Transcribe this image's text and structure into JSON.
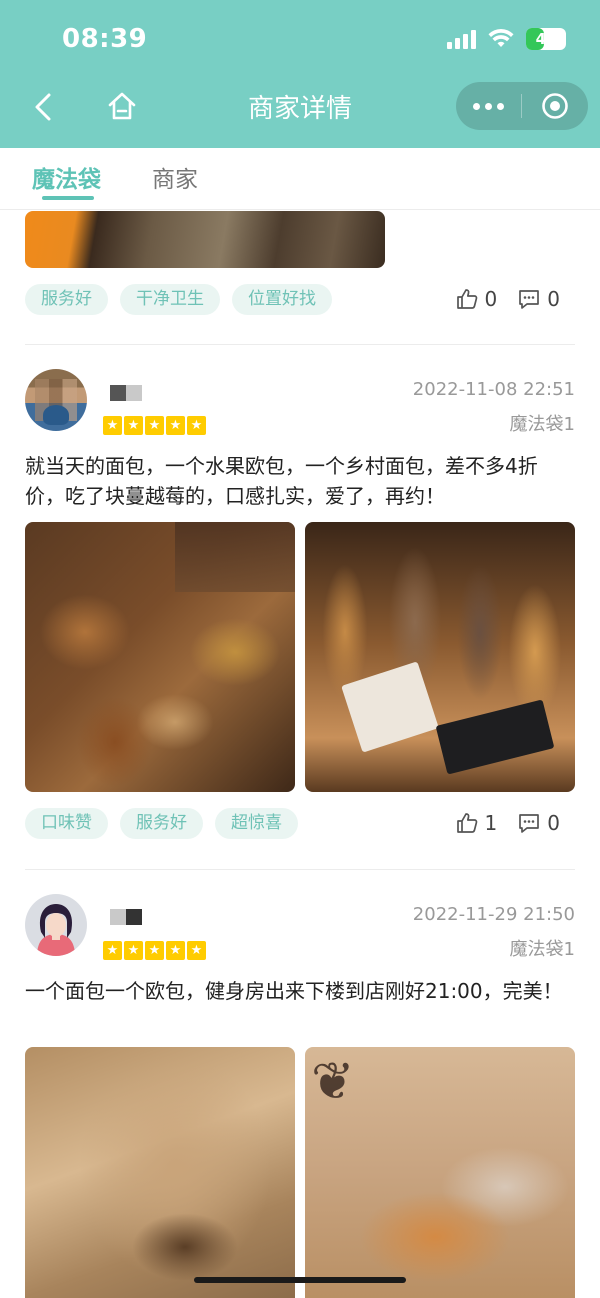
{
  "status": {
    "time": "08:39",
    "battery": "45",
    "battery_color": "#34c759"
  },
  "nav": {
    "title": "商家详情",
    "header_color": "#78cfc4"
  },
  "tabs": [
    {
      "label": "魔法袋",
      "active": true
    },
    {
      "label": "商家",
      "active": false
    }
  ],
  "reviews": [
    {
      "tags": [
        "服务好",
        "干净卫生",
        "位置好找"
      ],
      "likes": "0",
      "comments": "0"
    },
    {
      "date": "2022-11-08 22:51",
      "bag": "魔法袋1",
      "rating": 5,
      "text": "就当天的面包，一个水果欧包，一个乡村面包，差不多4折价，吃了块蔓越莓的，口感扎实，爱了，再约！",
      "tags": [
        "口味赞",
        "服务好",
        "超惊喜"
      ],
      "likes": "1",
      "comments": "0"
    },
    {
      "date": "2022-11-29 21:50",
      "bag": "魔法袋1",
      "rating": 5,
      "text": "一个面包一个欧包，健身房出来下楼到店刚好21:00，完美！"
    }
  ],
  "accent": "#5ec3b6",
  "tag_bg": "#eaf5f2",
  "star_color": "#ffcc00"
}
